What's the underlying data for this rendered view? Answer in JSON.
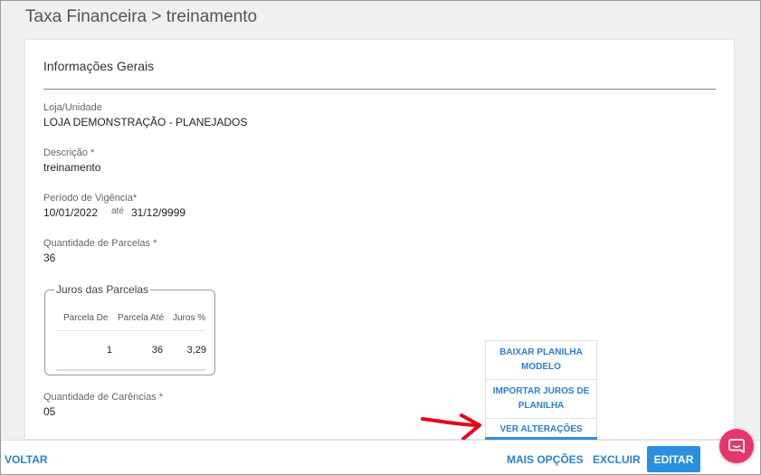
{
  "header": {
    "title": "Taxa Financeira > treinamento"
  },
  "section": {
    "title": "Informações Gerais"
  },
  "fields": {
    "loja": {
      "label": "Loja/Unidade",
      "value": "LOJA DEMONSTRAÇÃO - PLANEJADOS"
    },
    "descricao": {
      "label": "Descrição *",
      "value": "treinamento"
    },
    "vigencia": {
      "label": "Período de Vigência*",
      "start": "10/01/2022",
      "ate": "até",
      "end": "31/12/9999"
    },
    "parcelas": {
      "label": "Quantidade de Parcelas *",
      "value": "36"
    },
    "carencias": {
      "label": "Quantidade de Carências *",
      "value": "05"
    }
  },
  "juros": {
    "title": "Juros das Parcelas",
    "columns": [
      "Parcela De",
      "Parcela Até",
      "Juros %"
    ],
    "rows": [
      {
        "de": "1",
        "ate": "36",
        "juros": "3,29"
      }
    ]
  },
  "dropdown": {
    "items": [
      "BAIXAR PLANILHA MODELO",
      "IMPORTAR JUROS DE PLANILHA",
      "VER ALTERAÇÕES"
    ]
  },
  "footer": {
    "voltar": "VOLTAR",
    "mais_opcoes": "MAIS OPÇÕES",
    "excluir": "EXCLUIR",
    "editar": "EDITAR"
  },
  "colors": {
    "accent": "#2b8fe0",
    "chat": "#e8356b",
    "annotation": "#e8001a"
  },
  "icons": {
    "chat": "chat-icon",
    "annotation": "red-arrow-icon"
  }
}
